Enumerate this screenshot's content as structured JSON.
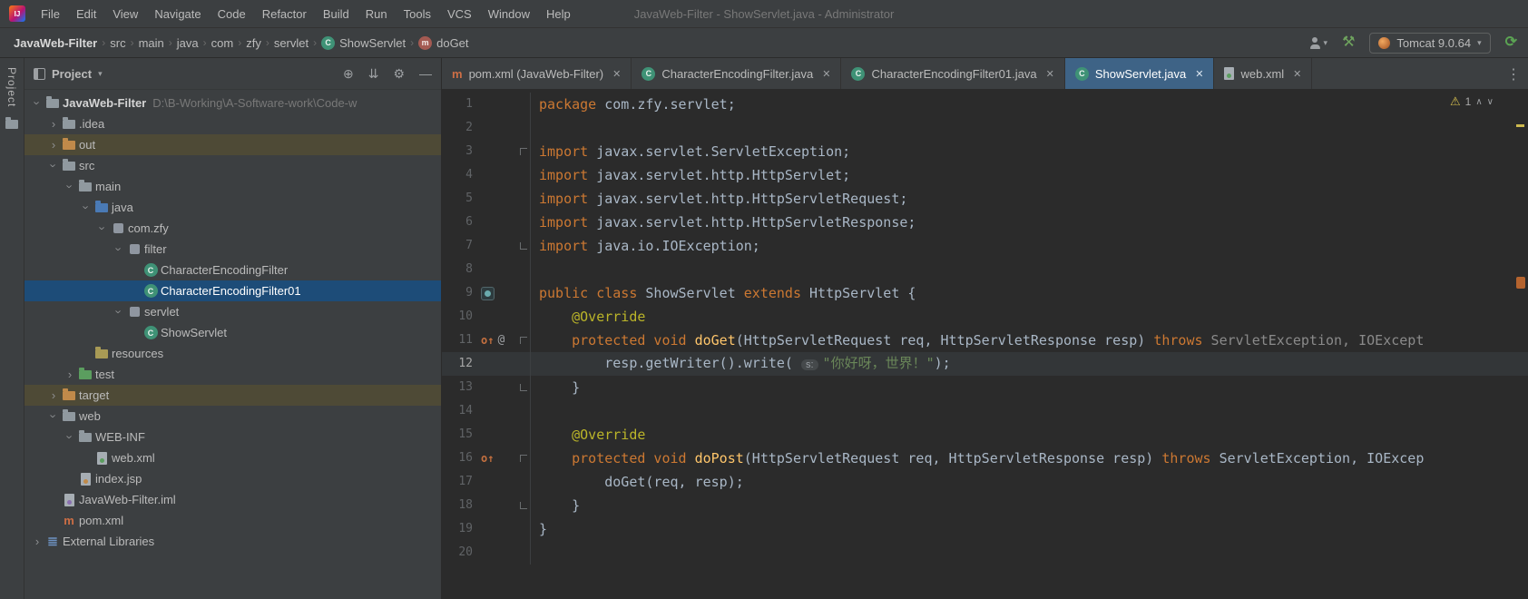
{
  "titlebar": {
    "title": "JavaWeb-Filter - ShowServlet.java - Administrator",
    "menu": [
      "File",
      "Edit",
      "View",
      "Navigate",
      "Code",
      "Refactor",
      "Build",
      "Run",
      "Tools",
      "VCS",
      "Window",
      "Help"
    ]
  },
  "navbar": {
    "breadcrumbs": [
      {
        "label": "JavaWeb-Filter"
      },
      {
        "label": "src"
      },
      {
        "label": "main"
      },
      {
        "label": "java"
      },
      {
        "label": "com"
      },
      {
        "label": "zfy"
      },
      {
        "label": "servlet"
      },
      {
        "label": "ShowServlet",
        "icon": "class"
      },
      {
        "label": "doGet",
        "icon": "method"
      }
    ],
    "run_config": "Tomcat 9.0.64"
  },
  "tool_strip": {
    "label": "Project"
  },
  "project_panel": {
    "title": "Project",
    "tree": [
      {
        "label": "JavaWeb-Filter",
        "extra": "D:\\B-Working\\A-Software-work\\Code-w",
        "depth": 0,
        "chevron": "expanded",
        "icon": "project"
      },
      {
        "label": ".idea",
        "depth": 1,
        "chevron": "collapsed",
        "icon": "folder"
      },
      {
        "label": "out",
        "depth": 1,
        "chevron": "collapsed",
        "icon": "folder-ex",
        "highlight": "olive"
      },
      {
        "label": "src",
        "depth": 1,
        "chevron": "expanded",
        "icon": "folder"
      },
      {
        "label": "main",
        "depth": 2,
        "chevron": "expanded",
        "icon": "folder"
      },
      {
        "label": "java",
        "depth": 3,
        "chevron": "expanded",
        "icon": "folder-src"
      },
      {
        "label": "com.zfy",
        "depth": 4,
        "chevron": "expanded",
        "icon": "package"
      },
      {
        "label": "filter",
        "depth": 5,
        "chevron": "expanded",
        "icon": "package"
      },
      {
        "label": "CharacterEncodingFilter",
        "depth": 6,
        "chevron": "none",
        "icon": "class"
      },
      {
        "label": "CharacterEncodingFilter01",
        "depth": 6,
        "chevron": "none",
        "icon": "class",
        "highlight": "selected"
      },
      {
        "label": "servlet",
        "depth": 5,
        "chevron": "expanded",
        "icon": "package"
      },
      {
        "label": "ShowServlet",
        "depth": 6,
        "chevron": "none",
        "icon": "class"
      },
      {
        "label": "resources",
        "depth": 3,
        "chevron": "none",
        "icon": "folder-res"
      },
      {
        "label": "test",
        "depth": 2,
        "chevron": "collapsed",
        "icon": "folder-test"
      },
      {
        "label": "target",
        "depth": 1,
        "chevron": "collapsed",
        "icon": "folder-ex",
        "highlight": "olive"
      },
      {
        "label": "web",
        "depth": 1,
        "chevron": "expanded",
        "icon": "folder"
      },
      {
        "label": "WEB-INF",
        "depth": 2,
        "chevron": "expanded",
        "icon": "folder"
      },
      {
        "label": "web.xml",
        "depth": 3,
        "chevron": "none",
        "icon": "xml"
      },
      {
        "label": "index.jsp",
        "depth": 2,
        "chevron": "none",
        "icon": "jsp"
      },
      {
        "label": "JavaWeb-Filter.iml",
        "depth": 1,
        "chevron": "none",
        "icon": "iml"
      },
      {
        "label": "pom.xml",
        "depth": 1,
        "chevron": "none",
        "icon": "maven"
      },
      {
        "label": "External Libraries",
        "depth": 0,
        "chevron": "collapsed",
        "icon": "libs"
      }
    ]
  },
  "tabs": [
    {
      "label": "pom.xml (JavaWeb-Filter)",
      "icon": "maven",
      "active": false
    },
    {
      "label": "CharacterEncodingFilter.java",
      "icon": "class",
      "active": false
    },
    {
      "label": "CharacterEncodingFilter01.java",
      "icon": "class",
      "active": false
    },
    {
      "label": "ShowServlet.java",
      "icon": "class",
      "active": true
    },
    {
      "label": "web.xml",
      "icon": "xml",
      "active": false
    }
  ],
  "editor": {
    "warning_count": "1",
    "lines": [
      {
        "num": "1",
        "tokens": [
          [
            "kw",
            "package"
          ],
          [
            "pl",
            " com.zfy.servlet;"
          ]
        ]
      },
      {
        "num": "2",
        "tokens": []
      },
      {
        "num": "3",
        "fold": "start",
        "tokens": [
          [
            "kw",
            "import"
          ],
          [
            "pl",
            " javax.servlet.ServletException;"
          ]
        ]
      },
      {
        "num": "4",
        "tokens": [
          [
            "kw",
            "import"
          ],
          [
            "pl",
            " javax.servlet.http.HttpServlet;"
          ]
        ]
      },
      {
        "num": "5",
        "tokens": [
          [
            "kw",
            "import"
          ],
          [
            "pl",
            " javax.servlet.http.HttpServletRequest;"
          ]
        ]
      },
      {
        "num": "6",
        "tokens": [
          [
            "kw",
            "import"
          ],
          [
            "pl",
            " javax.servlet.http.HttpServletResponse;"
          ]
        ]
      },
      {
        "num": "7",
        "fold": "end",
        "tokens": [
          [
            "kw",
            "import"
          ],
          [
            "pl",
            " java.io.IOException;"
          ]
        ]
      },
      {
        "num": "8",
        "tokens": []
      },
      {
        "num": "9",
        "gutter": [
          "class"
        ],
        "tokens": [
          [
            "kw",
            "public class"
          ],
          [
            "pl",
            " ShowServlet "
          ],
          [
            "kw",
            "extends"
          ],
          [
            "pl",
            " HttpServlet {"
          ]
        ]
      },
      {
        "num": "10",
        "tokens": [
          [
            "pl",
            "    "
          ],
          [
            "ann",
            "@Override"
          ]
        ]
      },
      {
        "num": "11",
        "gutter": [
          "override",
          "at"
        ],
        "fold": "start",
        "tokens": [
          [
            "pl",
            "    "
          ],
          [
            "kw",
            "protected void"
          ],
          [
            "pl",
            " "
          ],
          [
            "mth",
            "doGet"
          ],
          [
            "pl",
            "(HttpServletRequest req, HttpServletResponse resp) "
          ],
          [
            "kw",
            "throws"
          ],
          [
            "gr",
            " ServletException, IOExcept"
          ]
        ]
      },
      {
        "num": "12",
        "caret": true,
        "tokens": [
          [
            "pl",
            "        resp.getWriter().write( "
          ],
          [
            "hint",
            "s:"
          ],
          [
            "str",
            "\"你好呀，世界！\""
          ],
          [
            "pl",
            ");"
          ]
        ]
      },
      {
        "num": "13",
        "fold": "end",
        "tokens": [
          [
            "pl",
            "    }"
          ]
        ]
      },
      {
        "num": "14",
        "tokens": []
      },
      {
        "num": "15",
        "tokens": [
          [
            "pl",
            "    "
          ],
          [
            "ann",
            "@Override"
          ]
        ]
      },
      {
        "num": "16",
        "gutter": [
          "override"
        ],
        "fold": "start",
        "tokens": [
          [
            "pl",
            "    "
          ],
          [
            "kw",
            "protected void"
          ],
          [
            "pl",
            " "
          ],
          [
            "mth",
            "doPost"
          ],
          [
            "pl",
            "(HttpServletRequest req, HttpServletResponse resp) "
          ],
          [
            "kw",
            "throws"
          ],
          [
            "pl",
            " ServletException, IOExcep"
          ]
        ]
      },
      {
        "num": "17",
        "tokens": [
          [
            "pl",
            "        doGet(req, resp);"
          ]
        ]
      },
      {
        "num": "18",
        "fold": "end",
        "tokens": [
          [
            "pl",
            "    }"
          ]
        ]
      },
      {
        "num": "19",
        "tokens": [
          [
            "pl",
            "}"
          ]
        ]
      },
      {
        "num": "20",
        "tokens": []
      }
    ]
  },
  "colors": {
    "window_bg": "#3c3f41",
    "editor_bg": "#2b2b2b",
    "active_tab": "#3e6386",
    "tree_selection": "#1d4c78",
    "excluded_row": "#4e4a36",
    "keyword": "#cc7832",
    "string": "#6a8759",
    "annotation": "#bbb529"
  }
}
